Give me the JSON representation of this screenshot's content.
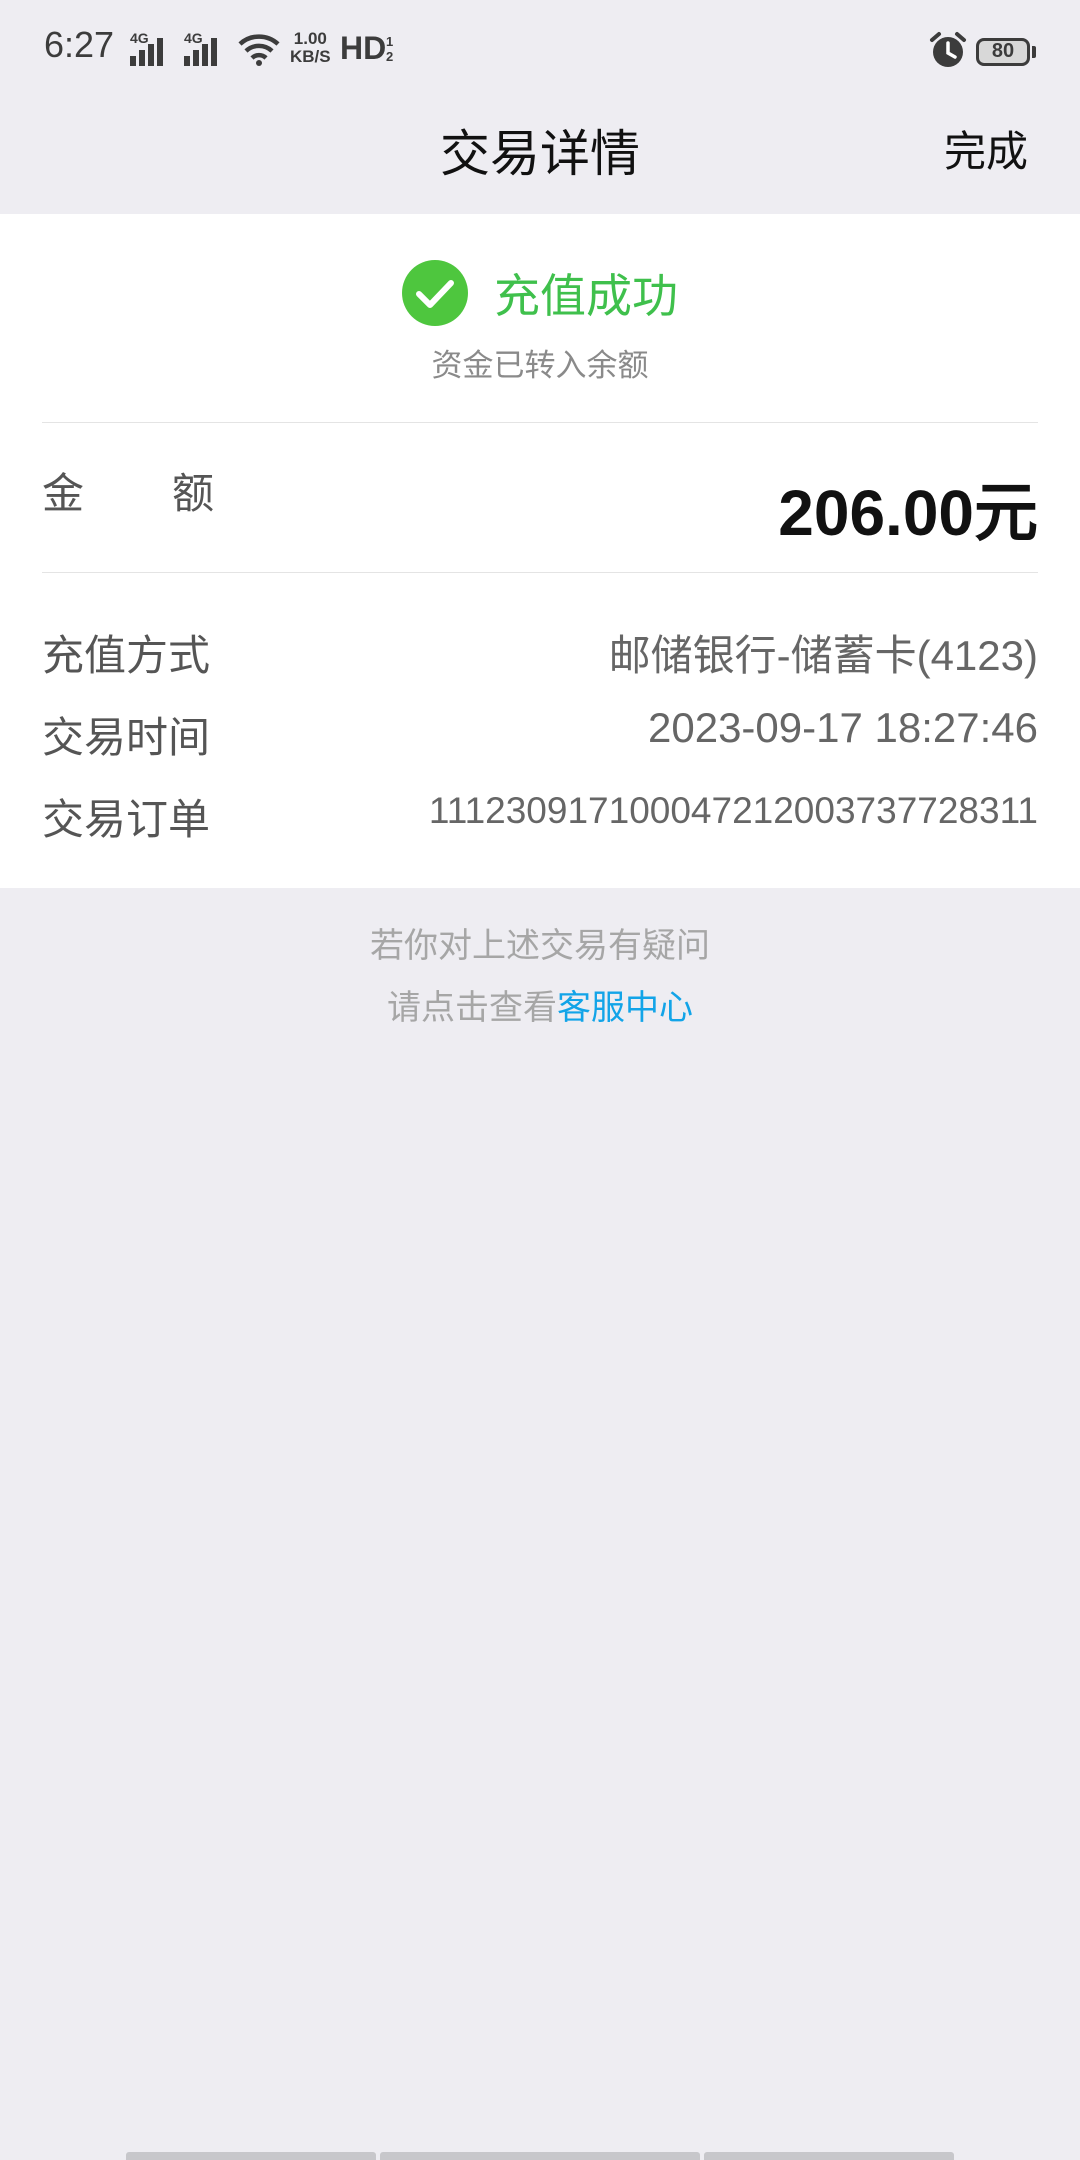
{
  "status_bar": {
    "time": "6:27",
    "signal1_label": "4G",
    "signal2_label": "4G",
    "speed_value": "1.00",
    "speed_unit": "KB/S",
    "hd_label": "HD",
    "hd_sub_1": "1",
    "hd_sub_2": "2",
    "battery_level": "80",
    "icons": [
      "signal-icon",
      "wifi-icon",
      "alarm-icon",
      "battery-icon"
    ]
  },
  "nav": {
    "title": "交易详情",
    "done_label": "完成"
  },
  "result": {
    "status_text": "充值成功",
    "status_sub": "资金已转入余额",
    "status_color": "#3fc04c"
  },
  "amount": {
    "label_char1": "金",
    "label_char2": "额",
    "value": "206.00",
    "unit": "元"
  },
  "details": {
    "method_label": "充值方式",
    "method_value": "邮储银行-储蓄卡(4123)",
    "time_label": "交易时间",
    "time_value": "2023-09-17 18:27:46",
    "order_label": "交易订单",
    "order_value": "111230917100047212003737728311"
  },
  "help": {
    "line1": "若你对上述交易有疑问",
    "line2_prefix": "请点击查看",
    "link_label": "客服中心",
    "link_color": "#12a4e8"
  }
}
